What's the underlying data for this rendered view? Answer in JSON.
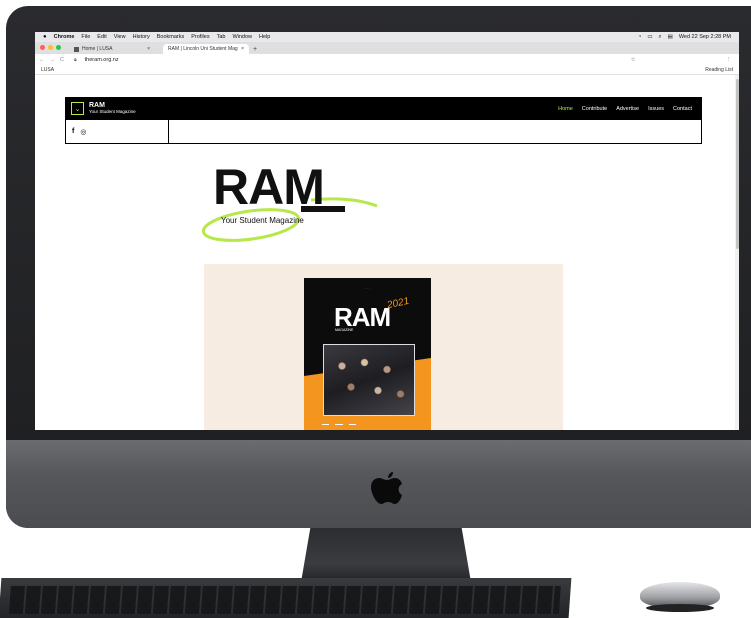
{
  "mac_menubar": {
    "app_name": "Chrome",
    "items": [
      "File",
      "Edit",
      "View",
      "History",
      "Bookmarks",
      "Profiles",
      "Tab",
      "Window",
      "Help"
    ],
    "clock": "Wed 22 Sep 2:28 PM"
  },
  "browser": {
    "tabs": [
      {
        "label": "Home | LUSA",
        "active": false
      },
      {
        "label": "RAM | Lincoln Uni Student Mag",
        "active": true
      }
    ],
    "url": "theram.org.nz",
    "bookmarks": [
      {
        "label": "LUSA"
      }
    ],
    "reading_list": "Reading List",
    "new_tab": "+",
    "close": "×"
  },
  "site": {
    "brand_title": "RAM",
    "brand_subtitle": "Your Student Magazine",
    "nav": [
      {
        "label": "Home",
        "active": true
      },
      {
        "label": "Contribute"
      },
      {
        "label": "Advertise"
      },
      {
        "label": "Issues"
      },
      {
        "label": "Contact"
      }
    ],
    "social": {
      "facebook": "f",
      "instagram": "◎"
    },
    "hero_logo": {
      "title": "RAM",
      "tagline": "Your Student Magazine"
    },
    "cover": {
      "title": "RAM",
      "year": "2021",
      "subtitle": "MAGAZINE"
    }
  },
  "colors": {
    "accent_green": "#b6e84a",
    "header_black": "#000000",
    "cover_bg": "#f7ece1",
    "magazine_orange": "#f3951f"
  }
}
